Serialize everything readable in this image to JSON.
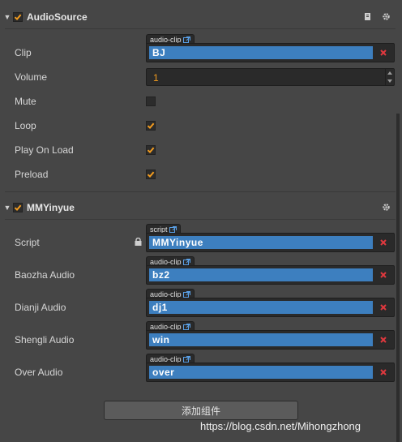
{
  "audio_source": {
    "title": "AudioSource",
    "enabled": true,
    "clip": {
      "label": "Clip",
      "tag": "audio-clip",
      "value": "BJ"
    },
    "volume": {
      "label": "Volume",
      "value": "1"
    },
    "mute": {
      "label": "Mute",
      "checked": false
    },
    "loop": {
      "label": "Loop",
      "checked": true
    },
    "play_on_load": {
      "label": "Play On Load",
      "checked": true
    },
    "preload": {
      "label": "Preload",
      "checked": true
    }
  },
  "mmyinyue": {
    "title": "MMYinyue",
    "enabled": true,
    "script": {
      "label": "Script",
      "tag": "script",
      "value": "MMYinyue"
    },
    "baozha_audio": {
      "label": "Baozha Audio",
      "tag": "audio-clip",
      "value": "bz2"
    },
    "dianji_audio": {
      "label": "Dianji Audio",
      "tag": "audio-clip",
      "value": "dj1"
    },
    "shengli_audio": {
      "label": "Shengli Audio",
      "tag": "audio-clip",
      "value": "win"
    },
    "over_audio": {
      "label": "Over Audio",
      "tag": "audio-clip",
      "value": "over"
    }
  },
  "add_component_label": "添加组件",
  "watermark": "https://blog.csdn.net/Mihongzhong",
  "colors": {
    "accent": "#3d7fbf",
    "check": "#f39c1f",
    "clear": "#e0383e"
  },
  "icons": [
    "collapse-arrow-icon",
    "checkbox-check-icon",
    "doc-icon",
    "gear-icon",
    "external-link-icon",
    "clear-x-icon",
    "lock-icon"
  ]
}
